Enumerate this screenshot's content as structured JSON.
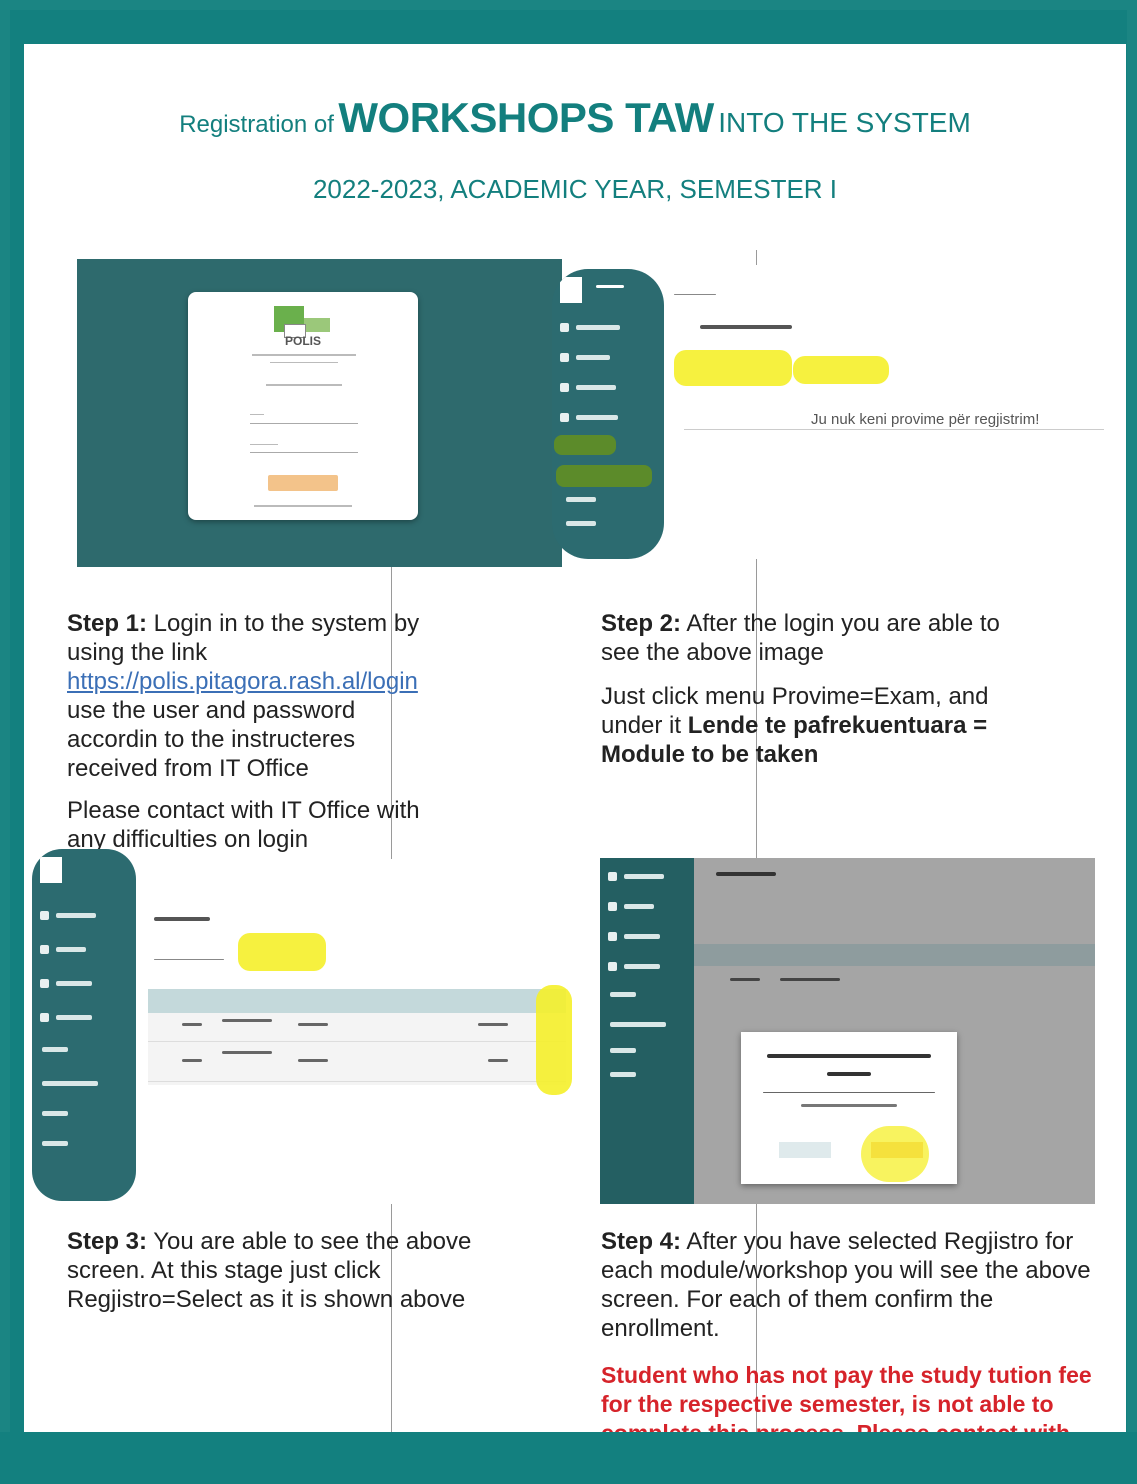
{
  "header": {
    "title_prefix": "Registration of",
    "title_main": "WORKSHOPS TAW",
    "title_suffix": "INTO THE SYSTEM",
    "subtitle": "2022-2023, ACADEMIC YEAR, SEMESTER I"
  },
  "screens": {
    "login": {
      "logo_text": "POLIS"
    },
    "exams": {
      "no_exams_text": "Ju nuk keni provime për regjistrim!"
    }
  },
  "steps": {
    "step1": {
      "label": "Step 1:",
      "text_a": " Login in to the system by using the link ",
      "link": "https://polis.pitagora.rash.al/login",
      "text_b": " use the user and password accordin to the instructeres received from IT Office",
      "note": "Please contact with IT Office with any difficulties on login"
    },
    "step2": {
      "label": "Step 2:",
      "text": " After the login you are able to see the above image",
      "text_2": "Just click menu Provime=Exam, and under it ",
      "text_2_bold": "Lende te pafrekuentuara = Module to be taken"
    },
    "step3": {
      "label": "Step 3:",
      "text": " You are able to see the above screen. At this stage just click Regjistro=Select as it is shown above"
    },
    "step4": {
      "label": "Step 4:",
      "text": " After you have selected Regjistro for each module/workshop you will see the above screen. For each of them confirm the enrollment.",
      "warning": "Student who has not pay the study tution fee for the respective semester, is not able to complete this process. Please contact with Finance office to confirm any payment"
    }
  },
  "colors": {
    "brand_teal": "#13807f",
    "sidebar": "#2c6b70",
    "highlight_yellow": "#f5ef2a",
    "warning_red": "#d6232a",
    "link_blue": "#3b6fb6"
  }
}
